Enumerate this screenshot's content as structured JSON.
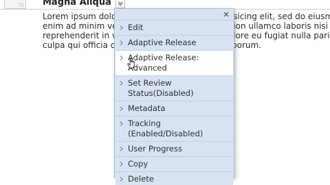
{
  "item": {
    "title": "Magna Aliqua",
    "body_lines": [
      "Lorem ipsum dolor sit amet, consectetur adipisicing elit, sed do eiusmod",
      "enim ad minim veniam, quis nostrud exercitation ullamco laboris nisi",
      "reprehenderit in voluptate velit esse cillum dolore eu fugiat nulla pariat",
      "culpa qui officia deserunt mollit anim id est laborum."
    ]
  },
  "menu": {
    "close_icon": "close-icon",
    "items": [
      {
        "label_lines": [
          "Edit"
        ]
      },
      {
        "label_lines": [
          "Adaptive Release"
        ]
      },
      {
        "label_lines": [
          "Adaptive Release:",
          "Advanced"
        ],
        "hovered": true
      },
      {
        "label_lines": [
          "Set Review",
          "Status(Disabled)"
        ]
      },
      {
        "label_lines": [
          "Metadata"
        ]
      },
      {
        "label_lines": [
          "Tracking",
          "(Enabled/Disabled)"
        ]
      },
      {
        "label_lines": [
          "User Progress"
        ]
      },
      {
        "label_lines": [
          "Copy"
        ]
      },
      {
        "label_lines": [
          "Delete"
        ]
      }
    ]
  },
  "colors": {
    "menu_bg": "#d7e3f3",
    "menu_border": "#a9bbd4",
    "hover_bg": "#ffffff"
  }
}
